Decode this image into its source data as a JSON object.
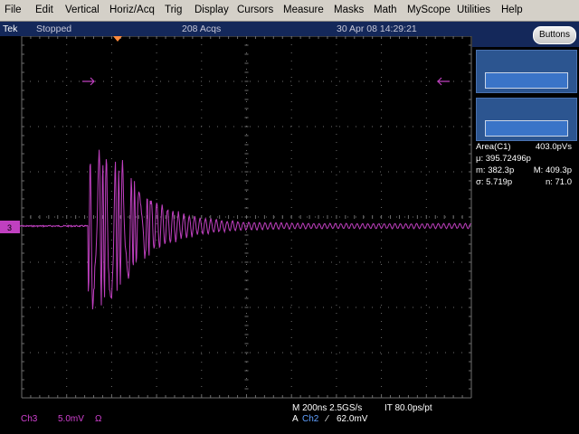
{
  "menu": [
    "File",
    "Edit",
    "Vertical",
    "Horiz/Acq",
    "Trig",
    "Display",
    "Cursors",
    "Measure",
    "Masks",
    "Math",
    "MyScope",
    "Utilities",
    "Help"
  ],
  "status": {
    "brand": "Tek",
    "state": "Stopped",
    "acqs": "208 Acqs",
    "datetime": "30 Apr 08 14:29:21"
  },
  "panel": {
    "buttons_label": "Buttons"
  },
  "measurements": {
    "title": "Area(C1)",
    "value": "403.0pVs",
    "mean": "μ: 395.72496p",
    "min": "m: 382.3p",
    "max": "M: 409.3p",
    "sigma": "σ: 5.719p",
    "n": "n: 71.0"
  },
  "channel": {
    "name": "Ch3",
    "scale": "5.0mV",
    "coupling": "Ω",
    "marker": "3"
  },
  "horizontal": {
    "timebase": "M 200ns 2.5GS/s",
    "interval": "IT 80.0ps/pt",
    "trigger_prefix": "A",
    "trigger_source": "Ch2",
    "trigger_slope": "⁄",
    "trigger_level": "62.0mV"
  },
  "colors": {
    "trace": "#c040c0",
    "channel_text": "#d040d0",
    "trigger_source": "#60a0ff",
    "grid": "#6e6e6e"
  }
}
